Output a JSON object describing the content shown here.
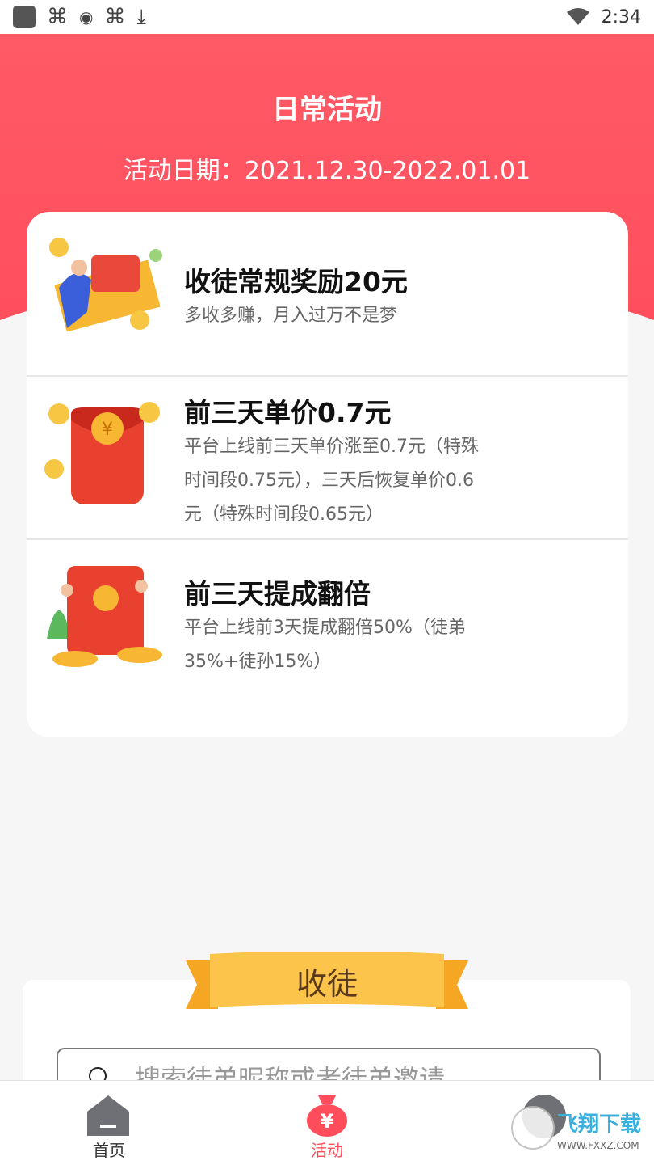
{
  "status_bar": {
    "time": "2:34",
    "icons": [
      "app-square-icon",
      "bug-icon",
      "shield-icon",
      "bug-icon",
      "download-icon",
      "wifi-icon"
    ]
  },
  "header": {
    "title": "日常活动",
    "date": "活动日期：2021.12.30-2022.01.01"
  },
  "activities": [
    {
      "title": "收徒常规奖励20元",
      "desc": "多收多赚，月入过万不是梦"
    },
    {
      "title": "前三天单价0.7元",
      "desc_lines": [
        "平台上线前三天单价涨至0.7元（特殊",
        "时间段0.75元），三天后恢复单价0.6",
        "元（特殊时间段0.65元）"
      ]
    },
    {
      "title": "前三天提成翻倍",
      "desc_lines": [
        "平台上线前3天提成翻倍50%（徒弟",
        "35%+徒孙15%）"
      ]
    }
  ],
  "recruit": {
    "banner": "收徒",
    "search_placeholder": "搜索徒弟昵称或者徒弟邀请"
  },
  "tabs": [
    {
      "label": "首页"
    },
    {
      "label": "活动"
    }
  ],
  "watermark": {
    "text": "飞翔下载",
    "url": "WWW.FXXZ.COM"
  },
  "colors": {
    "primary": "#ff4d5b",
    "gold": "#f7a81b"
  }
}
